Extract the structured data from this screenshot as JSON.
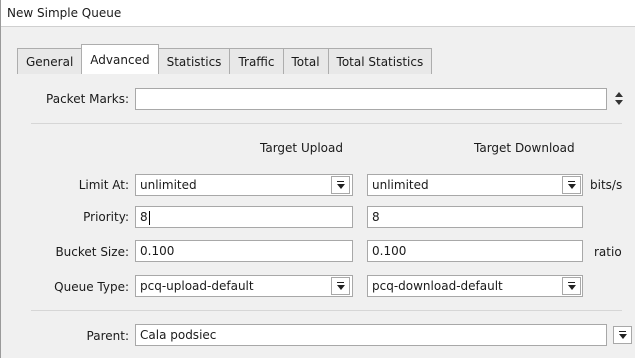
{
  "window": {
    "title": "New Simple Queue"
  },
  "tabs": [
    {
      "label": "General",
      "active": false
    },
    {
      "label": "Advanced",
      "active": true
    },
    {
      "label": "Statistics",
      "active": false
    },
    {
      "label": "Traffic",
      "active": false
    },
    {
      "label": "Total",
      "active": false
    },
    {
      "label": "Total Statistics",
      "active": false
    }
  ],
  "form": {
    "packet_marks": {
      "label": "Packet Marks:",
      "value": ""
    },
    "columns": {
      "upload": "Target Upload",
      "download": "Target Download"
    },
    "limit_at": {
      "label": "Limit At:",
      "upload": "unlimited",
      "download": "unlimited",
      "unit": "bits/s"
    },
    "priority": {
      "label": "Priority:",
      "upload": "8",
      "download": "8"
    },
    "bucket_size": {
      "label": "Bucket Size:",
      "upload": "0.100",
      "download": "0.100",
      "unit": "ratio"
    },
    "queue_type": {
      "label": "Queue Type:",
      "upload": "pcq-upload-default",
      "download": "pcq-download-default"
    },
    "parent": {
      "label": "Parent:",
      "value": "Cala podsiec"
    }
  },
  "icons": {
    "dropdown": "dropdown-arrow-icon",
    "updown": "up-down-arrow-icon"
  }
}
